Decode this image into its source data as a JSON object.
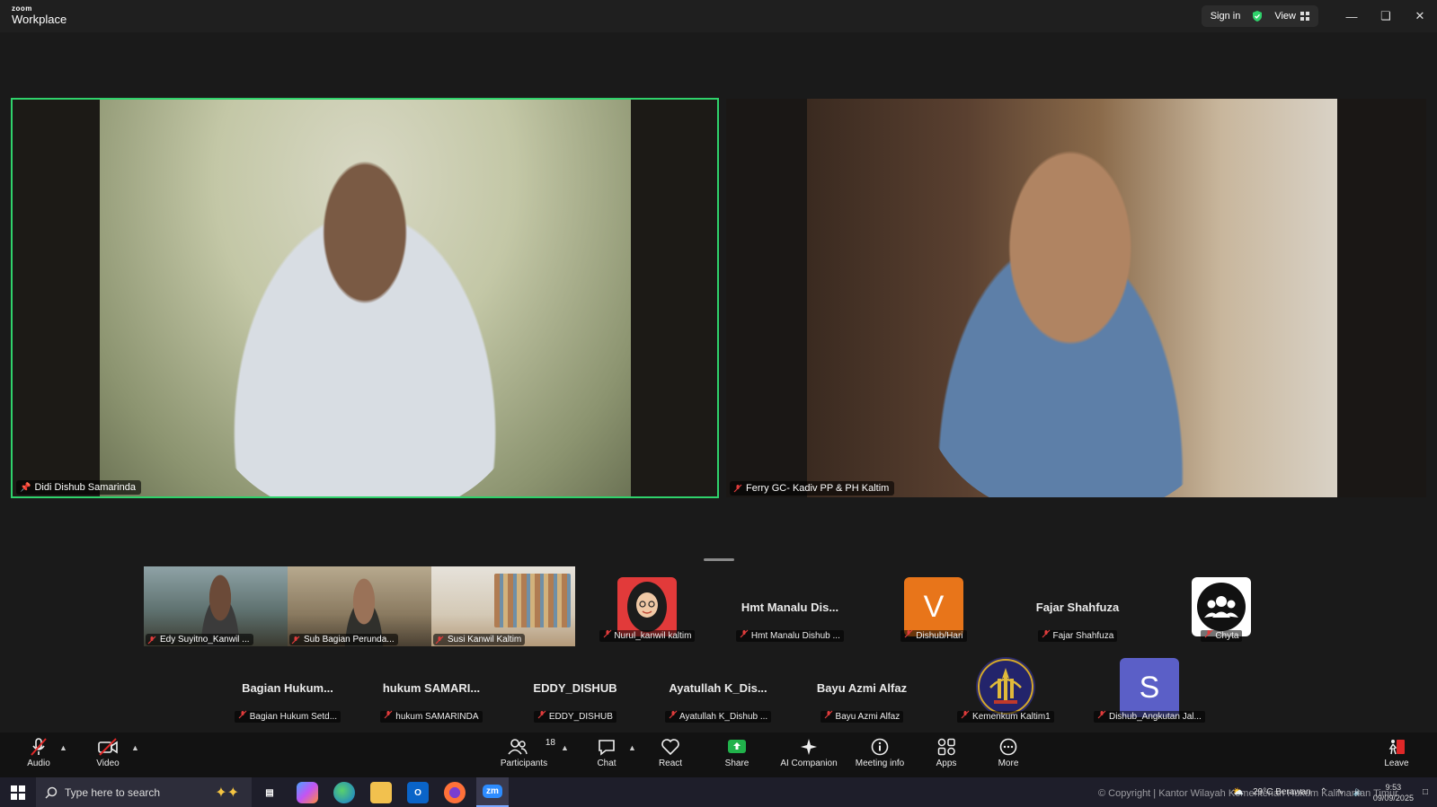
{
  "window": {
    "logo_top": "zoom",
    "logo_bottom": "Workplace",
    "sign_in": "Sign in",
    "view": "View"
  },
  "main_speakers": [
    {
      "name": "Didi Dishub Samarinda"
    },
    {
      "name": "Ferry GC- Kadiv PP & PH Kaltim"
    }
  ],
  "video_thumbs": [
    {
      "name": "Edy Suyitno_Kanwil ..."
    },
    {
      "name": "Sub Bagian Perunda..."
    },
    {
      "name": "Susi Kanwil Kaltim"
    }
  ],
  "row1": [
    {
      "display": "",
      "name": "Nurul_kanwil kaltim"
    },
    {
      "display": "Hmt  Manalu  Dis...",
      "name": "Hmt Manalu Dishub ..."
    },
    {
      "display": "V",
      "name": "Dishub/Hari"
    },
    {
      "display": "Fajar Shahfuza",
      "name": "Fajar Shahfuza"
    },
    {
      "display": "",
      "name": "Chyta"
    }
  ],
  "row2": [
    {
      "display": "Bagian  Hukum...",
      "name": "Bagian Hukum Setd..."
    },
    {
      "display": "hukum  SAMARI...",
      "name": "hukum SAMARINDA"
    },
    {
      "display": "EDDY_DISHUB",
      "name": "EDDY_DISHUB"
    },
    {
      "display": "Ayatullah  K_Dis...",
      "name": "Ayatullah K_Dishub ..."
    },
    {
      "display": "Bayu Azmi Alfaz",
      "name": "Bayu Azmi Alfaz"
    },
    {
      "display": "",
      "name": "Kemenkum Kaltim1"
    },
    {
      "display": "S",
      "name": "Dishub_Angkutan Jal..."
    }
  ],
  "toolbar": {
    "audio": "Audio",
    "video": "Video",
    "participants": "Participants",
    "participants_count": "18",
    "chat": "Chat",
    "react": "React",
    "share": "Share",
    "ai_companion": "AI Companion",
    "meeting_info": "Meeting info",
    "apps": "Apps",
    "more": "More",
    "leave": "Leave"
  },
  "taskbar": {
    "search_placeholder": "Type here to search",
    "zoom_label": "zm",
    "weather": "29°C  Berawan",
    "time": "9:53",
    "date": "09/09/2025"
  },
  "watermark": "© Copyright | Kantor Wilayah Kementerian Hukum Kalimantan Timur",
  "colors": {
    "active_speaker_border": "#2fd26b",
    "avatar_v": "#e8751a",
    "avatar_s": "#5b5fc7",
    "share_green": "#21b24b",
    "leave_red": "#e02828"
  }
}
